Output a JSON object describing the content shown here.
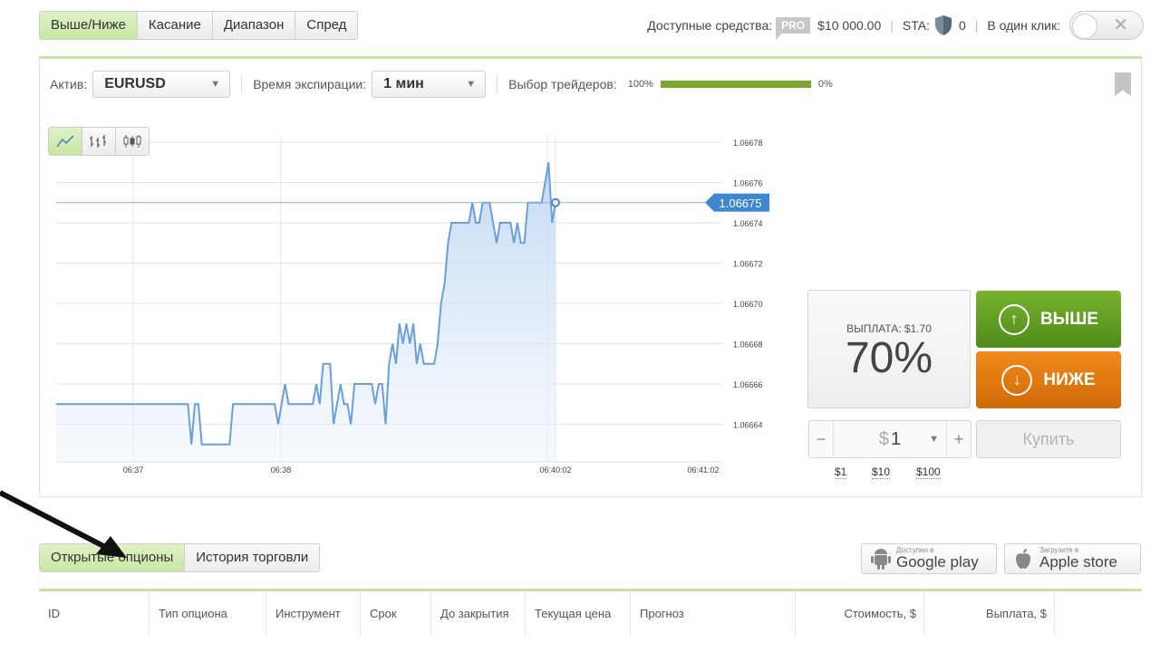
{
  "top_tabs": [
    "Выше/Ниже",
    "Касание",
    "Диапазон",
    "Спред"
  ],
  "balance": {
    "label": "Доступные средства:",
    "badge": "PRO",
    "amount": "$10 000.00"
  },
  "sta": {
    "label": "STA:",
    "value": "0"
  },
  "one_click": {
    "label": "В один клик:"
  },
  "toolbar": {
    "asset_label": "Актив:",
    "asset_value": "EURUSD",
    "expiry_label": "Время экспирации:",
    "expiry_value": "1 мин",
    "traders_label": "Выбор трейдеров:",
    "traders_left": "100%",
    "traders_right": "0%"
  },
  "chart_data": {
    "type": "line",
    "y_ticks": [
      "1.06678",
      "1.06676",
      "1.06674",
      "1.06672",
      "1.06670",
      "1.06668",
      "1.06666",
      "1.06664"
    ],
    "x_ticks": [
      "06:37",
      "06:38",
      "06:40:02",
      "06:41:02"
    ],
    "current_price": "1.06675",
    "ylim": [
      1.06662,
      1.06679
    ],
    "series": [
      {
        "values": [
          1.06665,
          1.06665,
          1.06665,
          1.06665,
          1.06665,
          1.06665,
          1.06665,
          1.06665,
          1.06665,
          1.06665,
          1.06665,
          1.06665,
          1.06665,
          1.06665,
          1.06665,
          1.06665,
          1.06665,
          1.06665,
          1.06665,
          1.06665,
          1.06665,
          1.06665,
          1.06665,
          1.06665,
          1.06665,
          1.06665,
          1.06665,
          1.06665,
          1.06665,
          1.06665,
          1.06665,
          1.06665,
          1.06665,
          1.06665,
          1.06665,
          1.06665,
          1.06665,
          1.06665,
          1.06665,
          1.06663,
          1.06665,
          1.06665,
          1.06663,
          1.06663,
          1.06663,
          1.06663,
          1.06663,
          1.06663,
          1.06663,
          1.06663,
          1.06663,
          1.06665,
          1.06665,
          1.06665,
          1.06665,
          1.06665,
          1.06665,
          1.06665,
          1.06665,
          1.06665,
          1.06665,
          1.06665,
          1.06665,
          1.06665,
          1.06664,
          1.06665,
          1.06666,
          1.06665,
          1.06665,
          1.06665,
          1.06665,
          1.06665,
          1.06665,
          1.06665,
          1.06665,
          1.06666,
          1.06665,
          1.06667,
          1.06667,
          1.06667,
          1.06664,
          1.06665,
          1.06666,
          1.06665,
          1.06665,
          1.06664,
          1.06666,
          1.06666,
          1.06666,
          1.06666,
          1.06666,
          1.06666,
          1.06665,
          1.06666,
          1.06666,
          1.06664,
          1.06667,
          1.06668,
          1.06667,
          1.06669,
          1.06668,
          1.06669,
          1.06668,
          1.06669,
          1.06667,
          1.06668,
          1.06667,
          1.06667,
          1.06667,
          1.06667,
          1.06668,
          1.0667,
          1.06671,
          1.06673,
          1.06674,
          1.06674,
          1.06674,
          1.06674,
          1.06674,
          1.06674,
          1.06675,
          1.06674,
          1.06674,
          1.06675,
          1.06675,
          1.06675,
          1.06674,
          1.06673,
          1.06674,
          1.06674,
          1.06674,
          1.06674,
          1.06673,
          1.06674,
          1.06673,
          1.06673,
          1.06675,
          1.06675,
          1.06675,
          1.06675,
          1.06675,
          1.06676,
          1.06677,
          1.06674,
          1.06675
        ]
      }
    ]
  },
  "trade": {
    "payout_label": "ВЫПЛАТА: $1.70",
    "payout_pct": "70%",
    "up_label": "ВЫШЕ",
    "down_label": "НИЖЕ",
    "amount": "1",
    "currency": "$",
    "buy_label": "Купить",
    "quick": [
      "$1",
      "$10",
      "$100"
    ]
  },
  "bottom_tabs": [
    "Открытые опционы",
    "История торговли"
  ],
  "stores": {
    "google_small": "Доступно в",
    "google_big": "Google play",
    "apple_small": "Загрузите в",
    "apple_big": "Apple store"
  },
  "table_headers": [
    "ID",
    "Тип опциона",
    "Инструмент",
    "Срок",
    "До закрытия",
    "Текущая цена",
    "Прогноз",
    "Стоимость, $",
    "Выплата, $"
  ]
}
